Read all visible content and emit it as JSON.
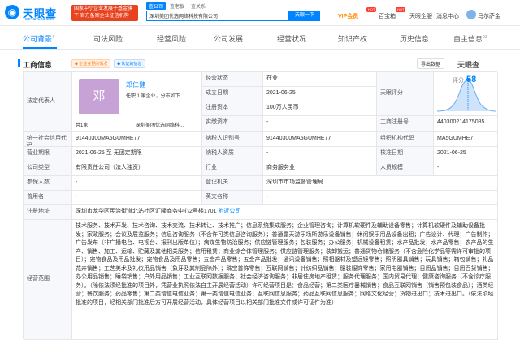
{
  "header": {
    "logo_text": "天眼查",
    "logo_sub": "TianYanCha.com",
    "promo_text": "国家中小企业发展子基金旗下 官方备案企业征信机构",
    "search_tabs": [
      "查公司",
      "查老板",
      "查关系"
    ],
    "search_value": "深圳美团优选网络科技有限公司",
    "search_button": "天眼一下",
    "nav_vip": "VIP会员",
    "nav_items": [
      "百宝箱",
      "天眼企服",
      "消息中心"
    ],
    "hot_badge": "HOT",
    "user_name": "马尔萨金"
  },
  "tabs": [
    {
      "label": "公司背景",
      "count": "4"
    },
    {
      "label": "司法风险",
      "count": ""
    },
    {
      "label": "经营风险",
      "count": ""
    },
    {
      "label": "公司发展",
      "count": ""
    },
    {
      "label": "经营状况",
      "count": ""
    },
    {
      "label": "知识产权",
      "count": ""
    },
    {
      "label": "历史信息",
      "count": ""
    },
    {
      "label": "自主信息",
      "count": "93"
    }
  ],
  "section": {
    "title": "工商信息",
    "tag1": "◆ 企业变更的情况",
    "tag2": "◆ 认证的信息",
    "export_label": "导出数据",
    "brand": "天眼查"
  },
  "rep": {
    "label": "法定代表人",
    "avatar_char": "邓",
    "name": "邓仁健",
    "sub": "任职 1 家企业，分布如下",
    "hint": "共1家",
    "company": "深圳美团优选网络科...",
    "status_label": "经营状态",
    "status": "在业",
    "est_label": "成立日期",
    "est": "2021-06-25",
    "cap_label": "注册资本",
    "cap": "100万人民币",
    "paid_label": "实缴资本",
    "paid": "-",
    "score_label": "天眼评分",
    "score_name": "评分",
    "score": "58",
    "bizno_label": "工商注册号",
    "bizno": "440300214175085"
  },
  "rows": {
    "uscc_label": "统一社会信用代码",
    "uscc": "91440300MA5GUMHE77",
    "tax_label": "纳税人识别号",
    "tax": "91440300MA5GUMHE77",
    "org_label": "组织机构代码",
    "org": "MA5GUMHE7",
    "term_label": "营业期限",
    "term": "2021-06-25 至 无固定期限",
    "taxq_label": "纳税人资质",
    "taxq": "-",
    "appr_label": "核准日期",
    "appr": "2021-06-25",
    "type_label": "公司类型",
    "type": "有限责任公司（法人独资）",
    "ind_label": "行业",
    "ind": "商务服务业",
    "staff_label": "人员规模",
    "staff": "-",
    "ins_label": "参保人数",
    "ins": "-",
    "reg_label": "登记机关",
    "reg": "深圳市市场监督管理局",
    "old_label": "曾用名",
    "old": "-",
    "en_label": "英文名称",
    "en": "-",
    "addr_label": "注册地址",
    "addr": "深圳市龙华区民治街道北站社区汇隆商务中心2号楼1701",
    "addr_link": "附近公司",
    "scope_label": "经营范围",
    "scope": "技术服务、技术开发、技术咨询、技术交流、技术转让、技术推广；信息系统集成服务；企业管理咨询；计算机软硬件及辅助设备零售；计算机软硬件及辅助设备批发；家政服务；会议及展览服务；信息咨询服务（不含许可类信息咨询服务）；普通露天游乐场所游乐设备销售；休闲娱乐用品设备出租；广告设计、代理；广告制作；广告发布（非广播电台、电视台、报刊出版单位）；病媒生物防治服务；供应链管理服务；包装服务；办公服务；机械设备租赁；水产品批发；水产品零售；农产品的生产、销售、加工、运输、贮藏及其他相关服务；信用租赁；商业综合体管理服务；供应链管理服务；装卸搬运；普通货物仓储服务（不含危险化学品等需许可审批的项目）；宠物食品及用品批发；宠物食品及用品零售；五金产品零售；五金产品批发；通讯设备销售；照相器材及望远镜零售；照明器具销售；玩具销售；箱包销售；礼品花卉销售；工艺美术及礼仪用品销售（象牙及其制品除外）；珠宝首饰零售；互联网销售；针纺织品销售；服装服饰零售；家用电器销售；日用品销售；日用百货销售；办公用品销售；睡袋销售；户外用品销售；工业互联网数据服务；社会经济咨询服务；非居住房地产租赁；服务代理服务；国内贸易代理；健康咨询服务（不含诊疗服务）。（除依法须经批准的项目外，凭营业执照依法自主开展经营活动）许可经营项目是：食品经营；第二类医疗器械销售；食品互联网销售（销售预包装食品）；酒类经营；餐饮服务；药品零售；第二类增值电信业务；第一类增值电信业务；互联网信息服务；药品互联网信息服务；网络文化经营；货物进出口；技术进出口。（依法须经批准的项目，经相关部门批准后方可开展经营活动，具体经营项目以相关部门批准文件或许可证件为准）"
  }
}
